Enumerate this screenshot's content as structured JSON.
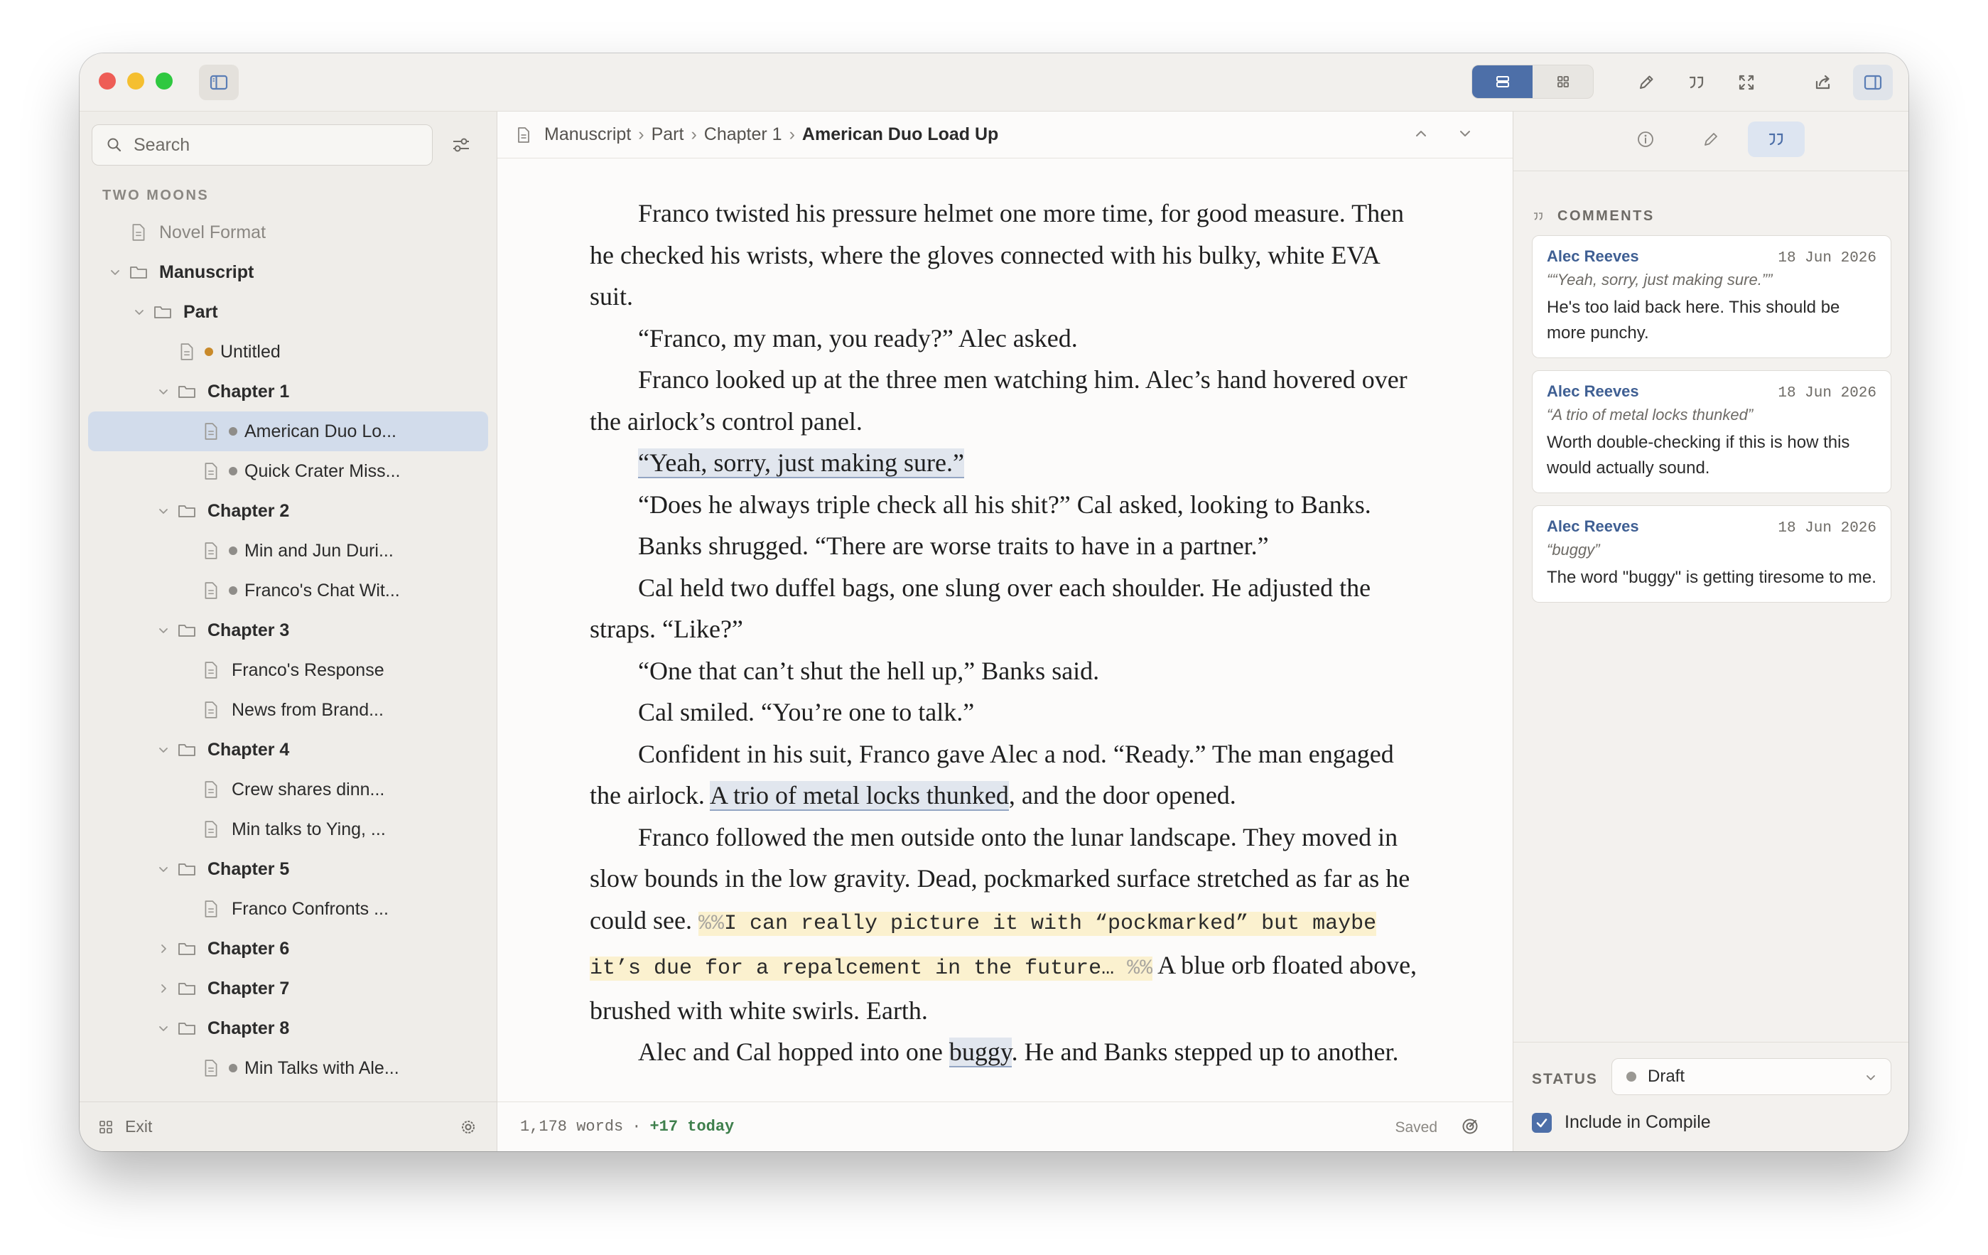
{
  "sidebar": {
    "search_placeholder": "Search",
    "project_title": "TWO MOONS",
    "exit_label": "Exit",
    "items": [
      {
        "label": "Novel Format",
        "kind": "doc",
        "depth": 0,
        "chevron": "none",
        "muted": true
      },
      {
        "label": "Manuscript",
        "kind": "folder",
        "depth": 0,
        "chevron": "down"
      },
      {
        "label": "Part",
        "kind": "folder",
        "depth": 1,
        "chevron": "down"
      },
      {
        "label": "Untitled",
        "kind": "doc",
        "depth": 2,
        "chevron": "none",
        "dot": "#c98a2a"
      },
      {
        "label": "Chapter 1",
        "kind": "folder",
        "depth": 2,
        "chevron": "down"
      },
      {
        "label": "American Duo Lo...",
        "kind": "doc",
        "depth": 3,
        "chevron": "none",
        "dot": "#8f8d89",
        "selected": true
      },
      {
        "label": "Quick Crater Miss...",
        "kind": "doc",
        "depth": 3,
        "chevron": "none",
        "dot": "#8f8d89"
      },
      {
        "label": "Chapter 2",
        "kind": "folder",
        "depth": 2,
        "chevron": "down"
      },
      {
        "label": "Min and Jun Duri...",
        "kind": "doc",
        "depth": 3,
        "chevron": "none",
        "dot": "#8f8d89"
      },
      {
        "label": "Franco's Chat Wit...",
        "kind": "doc",
        "depth": 3,
        "chevron": "none",
        "dot": "#8f8d89"
      },
      {
        "label": "Chapter 3",
        "kind": "folder",
        "depth": 2,
        "chevron": "down"
      },
      {
        "label": "Franco's Response",
        "kind": "doc",
        "depth": 3,
        "chevron": "none"
      },
      {
        "label": "News from Brand...",
        "kind": "doc",
        "depth": 3,
        "chevron": "none"
      },
      {
        "label": "Chapter 4",
        "kind": "folder",
        "depth": 2,
        "chevron": "down"
      },
      {
        "label": "Crew shares dinn...",
        "kind": "doc",
        "depth": 3,
        "chevron": "none"
      },
      {
        "label": "Min talks to Ying, ...",
        "kind": "doc",
        "depth": 3,
        "chevron": "none"
      },
      {
        "label": "Chapter 5",
        "kind": "folder",
        "depth": 2,
        "chevron": "down"
      },
      {
        "label": "Franco Confronts ...",
        "kind": "doc",
        "depth": 3,
        "chevron": "none"
      },
      {
        "label": "Chapter 6",
        "kind": "folder",
        "depth": 2,
        "chevron": "right"
      },
      {
        "label": "Chapter 7",
        "kind": "folder",
        "depth": 2,
        "chevron": "right"
      },
      {
        "label": "Chapter 8",
        "kind": "folder",
        "depth": 2,
        "chevron": "down"
      },
      {
        "label": "Min Talks with Ale...",
        "kind": "doc",
        "depth": 3,
        "chevron": "none",
        "dot": "#8f8d89"
      }
    ]
  },
  "editor": {
    "breadcrumb": [
      "Manuscript",
      "Part",
      "Chapter 1"
    ],
    "breadcrumb_current": "American Duo Load Up",
    "breadcrumb_separator": "›",
    "paragraphs": {
      "p1": "Franco twisted his pressure helmet one more time, for good measure. Then he checked his wrists, where the gloves connected with his bulky, white EVA suit.",
      "p2": "“Franco, my man, you ready?” Alec asked.",
      "p3": "Franco looked up at the three men watching him. Alec’s hand hovered over the airlock’s control panel.",
      "p4_hl": "“Yeah, sorry, just making sure.”",
      "p5": "“Does he always triple check all his shit?” Cal asked, looking to Banks.",
      "p6": "Banks shrugged. “There are worse traits to have in a partner.”",
      "p7": "Cal held two duffel bags, one slung over each shoulder. He adjusted the straps. “Like?”",
      "p8": "“One that can’t shut the hell up,” Banks said.",
      "p9": "Cal smiled. “You’re one to talk.”",
      "p10_a": "Confident in his suit, Franco gave Alec a nod. “Ready.” The man engaged the airlock. ",
      "p10_hl": "A trio of metal locks thunked",
      "p10_b": ", and the door opened.",
      "p11_a": "Franco followed the men outside onto the lunar landscape. They moved in slow bounds in the low gravity. Dead, pockmarked surface stretched as far as he could see. ",
      "p11_mark_open": "%%",
      "p11_comment": "I can really picture it with “pockmarked” but maybe it’s due for a repalcement in the future… ",
      "p11_mark_close": "%%",
      "p11_b": " A blue orb floated above, brushed with white swirls. Earth.",
      "p12_a": "Alec and Cal hopped into one ",
      "p12_hl": "buggy",
      "p12_b": ". He and Banks stepped up to another."
    },
    "footer": {
      "word_count": "1,178 words",
      "separator": "·",
      "today": "+17 today",
      "saved": "Saved"
    }
  },
  "inspector": {
    "comments_title": "COMMENTS",
    "comments": [
      {
        "author": "Alec Reeves",
        "date": "18 Jun 2026",
        "quote": "““Yeah, sorry, just making sure.””",
        "text": "He's too laid back here. This should be more punchy."
      },
      {
        "author": "Alec Reeves",
        "date": "18 Jun 2026",
        "quote": "“A trio of metal locks thunked”",
        "text": "Worth double-checking if this is how this would actually sound."
      },
      {
        "author": "Alec Reeves",
        "date": "18 Jun 2026",
        "quote": "“buggy”",
        "text": "The word \"buggy\" is getting tiresome to me."
      }
    ],
    "status_label": "STATUS",
    "status_value": "Draft",
    "compile_label": "Include in Compile",
    "compile_checked": true
  },
  "colors": {
    "accent": "#4d6fa8",
    "author": "#3f5f93",
    "today": "#3e7f4c",
    "comment_bg": "#fbf1cf",
    "highlight_bg": "#e1e6ee",
    "selected_row": "#d2dceb"
  }
}
